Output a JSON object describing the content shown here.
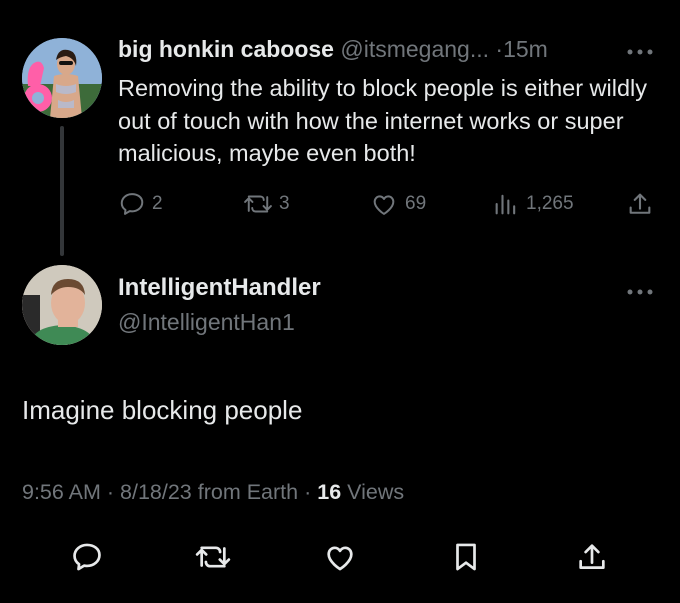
{
  "parent_tweet": {
    "author_name": "big honkin caboose",
    "handle": "@itsmegang...",
    "separator": "·",
    "time": "15m",
    "text": "Removing the ability to block people is either wildly out of touch with how the internet works or super malicious, maybe even both!",
    "replies": "2",
    "retweets": "3",
    "likes": "69",
    "views": "1,265"
  },
  "reply": {
    "author_name": "IntelligentHandler",
    "handle": "@IntelligentHan1",
    "text": "Imagine blocking people",
    "time": "9:56 AM",
    "separator1": "·",
    "date": "8/18/23 from Earth",
    "separator2": "·",
    "views_count": "16",
    "views_label": "Views"
  },
  "colors": {
    "background": "#000000",
    "text_primary": "#e7e9ea",
    "text_muted": "#71767b",
    "icon_bottom": "#e7e9ea",
    "thread_line": "#333639"
  },
  "icons": {
    "reply": "reply-icon",
    "retweet": "retweet-icon",
    "like": "heart-icon",
    "views": "views-chart-icon",
    "share": "share-icon",
    "bookmark": "bookmark-icon",
    "more": "more-dots-icon"
  }
}
